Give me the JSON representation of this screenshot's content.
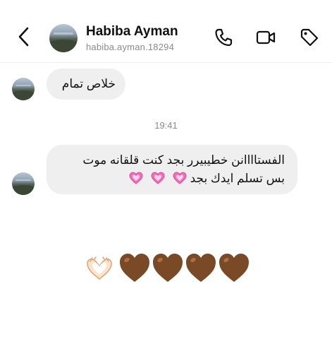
{
  "header": {
    "contact_name": "Habiba Ayman",
    "contact_handle": "habiba.ayman.18294",
    "icons": [
      "back-icon",
      "phone-icon",
      "video-icon",
      "tag-icon"
    ]
  },
  "messages": [
    {
      "sender": "contact",
      "text": "خلاص تمام"
    },
    {
      "type": "timestamp",
      "text": "19:41"
    },
    {
      "sender": "contact",
      "line1": "الفستاااانن خطيبيرر بجد كنت قلقانه موت",
      "line2": "بس تسلم ايدك بجد",
      "trailing_emoji": "sparkling-heart x3"
    }
  ],
  "reaction": {
    "emojis": [
      "heart-hands",
      "brown-heart",
      "brown-heart",
      "brown-heart",
      "brown-heart"
    ]
  },
  "colors": {
    "bubble": "#efefef",
    "text": "#111111",
    "secondary_text": "#8a8a8a",
    "brown_heart": "#7a4a26",
    "pink_heart": "#f06fb6"
  }
}
